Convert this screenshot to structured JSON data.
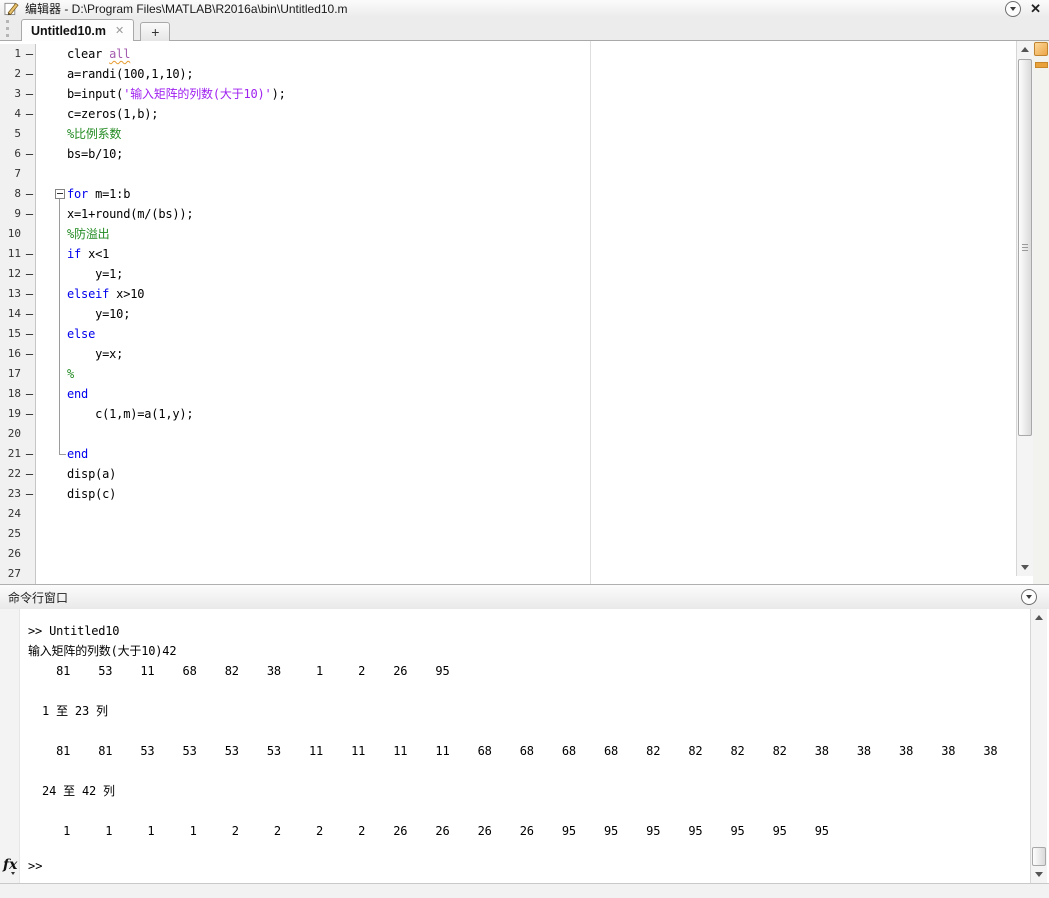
{
  "window": {
    "title": "编辑器 - D:\\Program Files\\MATLAB\\R2016a\\bin\\Untitled10.m",
    "icon": "editor-pencil-icon",
    "undock_glyph": "▼",
    "close_glyph": "✕"
  },
  "tabs": {
    "active_label": "Untitled10.m",
    "close_glyph": "✕",
    "add_glyph": "+"
  },
  "editor": {
    "lines": [
      {
        "n": 1,
        "d": true,
        "f": "",
        "s": [
          [
            "clear ",
            "p"
          ],
          [
            "all",
            "w"
          ]
        ]
      },
      {
        "n": 2,
        "d": true,
        "f": "",
        "s": [
          [
            "a=randi(100,1,10);",
            "p"
          ]
        ]
      },
      {
        "n": 3,
        "d": true,
        "f": "",
        "s": [
          [
            "b=input(",
            "p"
          ],
          [
            "'输入矩阵的列数(大于10)'",
            "str"
          ],
          [
            ");",
            "p"
          ]
        ]
      },
      {
        "n": 4,
        "d": true,
        "f": "",
        "s": [
          [
            "c=zeros(1,b);",
            "p"
          ]
        ]
      },
      {
        "n": 5,
        "d": false,
        "f": "",
        "s": [
          [
            "%比例系数",
            "c"
          ]
        ]
      },
      {
        "n": 6,
        "d": true,
        "f": "",
        "s": [
          [
            "bs=b/10;",
            "p"
          ]
        ]
      },
      {
        "n": 7,
        "d": false,
        "f": "",
        "s": []
      },
      {
        "n": 8,
        "d": true,
        "f": "start",
        "s": [
          [
            "for",
            "k"
          ],
          [
            " m=1:b",
            "p"
          ]
        ]
      },
      {
        "n": 9,
        "d": true,
        "f": "mid",
        "s": [
          [
            "x=1+round(m/(bs));",
            "p"
          ]
        ]
      },
      {
        "n": 10,
        "d": false,
        "f": "mid",
        "s": [
          [
            "%防溢出",
            "c"
          ]
        ]
      },
      {
        "n": 11,
        "d": true,
        "f": "mid",
        "s": [
          [
            "if",
            "k"
          ],
          [
            " x<1",
            "p"
          ]
        ]
      },
      {
        "n": 12,
        "d": true,
        "f": "mid",
        "s": [
          [
            "    y=1;",
            "p"
          ]
        ]
      },
      {
        "n": 13,
        "d": true,
        "f": "mid",
        "s": [
          [
            "elseif",
            "k"
          ],
          [
            " x>10",
            "p"
          ]
        ]
      },
      {
        "n": 14,
        "d": true,
        "f": "mid",
        "s": [
          [
            "    y=10;",
            "p"
          ]
        ]
      },
      {
        "n": 15,
        "d": true,
        "f": "mid",
        "s": [
          [
            "else",
            "k"
          ]
        ]
      },
      {
        "n": 16,
        "d": true,
        "f": "mid",
        "s": [
          [
            "    y=x;",
            "p"
          ]
        ]
      },
      {
        "n": 17,
        "d": false,
        "f": "mid",
        "s": [
          [
            "%",
            "c"
          ]
        ]
      },
      {
        "n": 18,
        "d": true,
        "f": "mid",
        "s": [
          [
            "end",
            "k"
          ]
        ]
      },
      {
        "n": 19,
        "d": true,
        "f": "mid",
        "s": [
          [
            "    c(1,m)=a(1,y);",
            "p"
          ]
        ]
      },
      {
        "n": 20,
        "d": false,
        "f": "mid",
        "s": []
      },
      {
        "n": 21,
        "d": true,
        "f": "end",
        "s": [
          [
            "end",
            "k"
          ]
        ]
      },
      {
        "n": 22,
        "d": true,
        "f": "",
        "s": [
          [
            "disp(a)",
            "p"
          ]
        ]
      },
      {
        "n": 23,
        "d": true,
        "f": "",
        "s": [
          [
            "disp(c)",
            "p"
          ]
        ]
      },
      {
        "n": 24,
        "d": false,
        "f": "",
        "s": []
      },
      {
        "n": 25,
        "d": false,
        "f": "",
        "s": []
      },
      {
        "n": 26,
        "d": false,
        "f": "",
        "s": []
      },
      {
        "n": 27,
        "d": false,
        "f": "",
        "s": []
      }
    ]
  },
  "command_window": {
    "header": "命令行窗口",
    "lines": [
      ">> Untitled10",
      "输入矩阵的列数(大于10)42",
      "    81    53    11    68    82    38     1     2    26    95",
      "",
      "  1 至 23 列",
      "",
      "    81    81    53    53    53    53    11    11    11    11    68    68    68    68    82    82    82    82    38    38    38    38    38",
      "",
      "  24 至 42 列",
      "",
      "     1     1     1     1     2     2     2     2    26    26    26    26    95    95    95    95    95    95    95",
      ""
    ],
    "fx_label": "fx",
    "prompt": ">>"
  },
  "colors": {
    "keyword": "#0000ee",
    "comment": "#228b22",
    "string": "#a020f0",
    "warning_text": "#a45bb0",
    "warning_underline": "#e69a2e",
    "analyzer_indicator": "#eda648"
  }
}
